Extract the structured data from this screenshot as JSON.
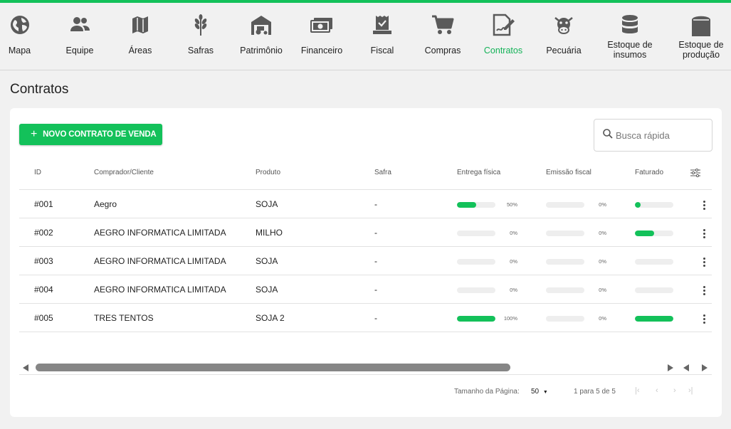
{
  "nav": {
    "items": [
      {
        "label": "Mapa",
        "icon": "globe-icon"
      },
      {
        "label": "Equipe",
        "icon": "people-icon"
      },
      {
        "label": "Áreas",
        "icon": "map-icon"
      },
      {
        "label": "Safras",
        "icon": "wheat-icon"
      },
      {
        "label": "Patrimônio",
        "icon": "barn-tractor-icon"
      },
      {
        "label": "Financeiro",
        "icon": "money-icon"
      },
      {
        "label": "Fiscal",
        "icon": "fiscal-receipt-icon"
      },
      {
        "label": "Compras",
        "icon": "cart-icon"
      },
      {
        "label": "Contratos",
        "icon": "contract-sign-icon"
      },
      {
        "label": "Pecuária",
        "icon": "cow-icon"
      },
      {
        "label_1": "Estoque de",
        "label_2": "insumos",
        "icon": "database-icon"
      },
      {
        "label_1": "Estoque de",
        "label_2": "produção",
        "icon": "silo-icon"
      }
    ],
    "active": "Contratos",
    "accent_color": "#13c15a"
  },
  "page": {
    "title": "Contratos"
  },
  "toolbar": {
    "new_button_label": "NOVO CONTRATO DE VENDA",
    "new_button_icon": "plus-icon",
    "search_placeholder": "Busca rápida",
    "search_icon": "search-icon"
  },
  "table": {
    "columns": [
      "ID",
      "Comprador/Cliente",
      "Produto",
      "Safra",
      "Entrega física",
      "Emissão fiscal",
      "Faturado"
    ],
    "settings_icon": "column-settings-icon",
    "rows": [
      {
        "id": "#001",
        "cliente": "Aegro",
        "produto": "SOJA",
        "safra": "-",
        "entrega": 0.5,
        "entrega_label": "50%",
        "emissao": 0,
        "emissao_label": "0%",
        "faturado": 0.15
      },
      {
        "id": "#002",
        "cliente": "AEGRO INFORMATICA LIMITADA",
        "produto": "MILHO",
        "safra": "-",
        "entrega": 0,
        "entrega_label": "0%",
        "emissao": 0,
        "emissao_label": "0%",
        "faturado": 0.5
      },
      {
        "id": "#003",
        "cliente": "AEGRO INFORMATICA LIMITADA",
        "produto": "SOJA",
        "safra": "-",
        "entrega": 0,
        "entrega_label": "0%",
        "emissao": 0,
        "emissao_label": "0%",
        "faturado": 0
      },
      {
        "id": "#004",
        "cliente": "AEGRO INFORMATICA LIMITADA",
        "produto": "SOJA",
        "safra": "-",
        "entrega": 0,
        "entrega_label": "0%",
        "emissao": 0,
        "emissao_label": "0%",
        "faturado": 0
      },
      {
        "id": "#005",
        "cliente": "TRES TENTOS",
        "produto": "SOJA 2",
        "safra": "-",
        "entrega": 1,
        "entrega_label": "100%",
        "emissao": 0,
        "emissao_label": "0%",
        "faturado": 1
      }
    ]
  },
  "pagination": {
    "page_size_label": "Tamanho da Página:",
    "page_size": "50",
    "range_label": "1 para 5 de 5",
    "first": "|‹",
    "prev": "‹",
    "next": "›",
    "last": "›|"
  }
}
